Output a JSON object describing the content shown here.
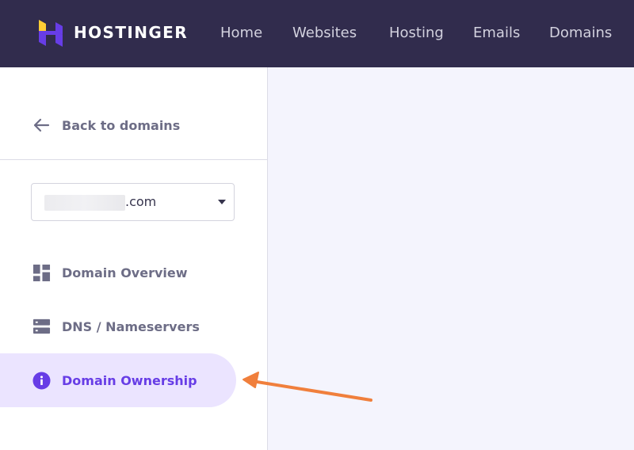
{
  "brand": {
    "name": "HOSTINGER"
  },
  "nav": {
    "items": [
      {
        "label": "Home"
      },
      {
        "label": "Websites"
      },
      {
        "label": "Hosting"
      },
      {
        "label": "Emails"
      },
      {
        "label": "Domains"
      }
    ]
  },
  "sidebar": {
    "back_label": "Back to domains",
    "domain_select": {
      "suffix": ".com"
    },
    "items": [
      {
        "label": "Domain Overview",
        "icon": "dashboard-icon"
      },
      {
        "label": "DNS / Nameservers",
        "icon": "server-icon"
      },
      {
        "label": "Domain Ownership",
        "icon": "info-icon",
        "active": true
      }
    ]
  },
  "colors": {
    "topbar": "#312c4d",
    "accent": "#673de6",
    "active_bg": "#ebe4ff",
    "annotation_arrow": "#f07f3c"
  }
}
